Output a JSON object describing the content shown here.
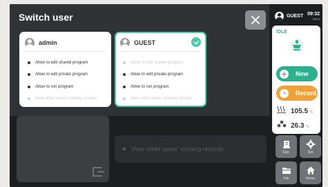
{
  "modal": {
    "title": "Switch user",
    "close_label": "×"
  },
  "users": [
    {
      "name": "admin",
      "selected": false,
      "permissions": [
        {
          "label": "Allow to edit shared program",
          "enabled": true
        },
        {
          "label": "Allow to edit private program",
          "enabled": true
        },
        {
          "label": "Allow to run program",
          "enabled": true
        },
        {
          "label": "View other users' running records",
          "enabled": false
        }
      ]
    },
    {
      "name": "GUEST",
      "selected": true,
      "permissions": [
        {
          "label": "Allow to edit shared program",
          "enabled": false
        },
        {
          "label": "Allow to edit private program",
          "enabled": true
        },
        {
          "label": "Allow to run program",
          "enabled": true
        },
        {
          "label": "View other users' running records",
          "enabled": false
        }
      ]
    }
  ],
  "background": {
    "record_label": "View other users' running records"
  },
  "status_bar": {
    "user": "GUEST",
    "time": "09:32",
    "date": "09/14"
  },
  "side_panel": {
    "state": "IDLE",
    "new_label": "New",
    "recent_label": "Recent",
    "temp1_value": "105.5",
    "temp1_unit": "°C",
    "temp2_value": "26.3",
    "temp2_unit": "°C"
  },
  "tiles": {
    "exp": "Exp.",
    "set": "Set",
    "file": "File",
    "home": "Home"
  },
  "colors": {
    "accent_green": "#2eb08e",
    "selected_border": "#4fc9ad",
    "recent_orange": "#f0a13a",
    "overlay": "#2f3336",
    "screen_bg": "#1c1e20"
  },
  "icons": {
    "close": "close-icon",
    "check": "check-icon",
    "avatar": "user-avatar-icon",
    "machine": "machine-icon",
    "plus": "plus-icon",
    "clock": "clock-icon",
    "exit": "exit-icon"
  }
}
